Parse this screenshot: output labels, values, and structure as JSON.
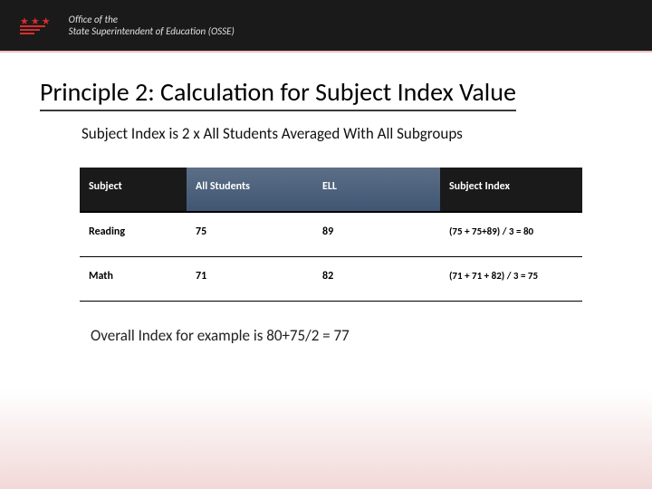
{
  "header": {
    "line1": "Office of the",
    "line2": "State Superintendent of Education (OSSE)"
  },
  "title": "Principle 2: Calculation for Subject Index Value",
  "subtitle": "Subject Index is 2 x All Students Averaged With All Subgroups",
  "table": {
    "headers": [
      "Subject",
      "All Students",
      "ELL",
      "Subject Index"
    ],
    "rows": [
      {
        "subject": "Reading",
        "all_students": "75",
        "ell": "89",
        "formula": "(75 + 75+89) /  3 = 80"
      },
      {
        "subject": "Math",
        "all_students": "71",
        "ell": "82",
        "formula": "(71 + 71 + 82) /  3 = 75"
      }
    ]
  },
  "overall": "Overall Index for example is 80+75/2 = 77",
  "chart_data": {
    "type": "table",
    "title": "Subject Index Calculation",
    "columns": [
      "Subject",
      "All Students",
      "ELL",
      "Subject Index"
    ],
    "rows": [
      [
        "Reading",
        75,
        89,
        80
      ],
      [
        "Math",
        71,
        82,
        75
      ]
    ],
    "overall_index": 77
  }
}
